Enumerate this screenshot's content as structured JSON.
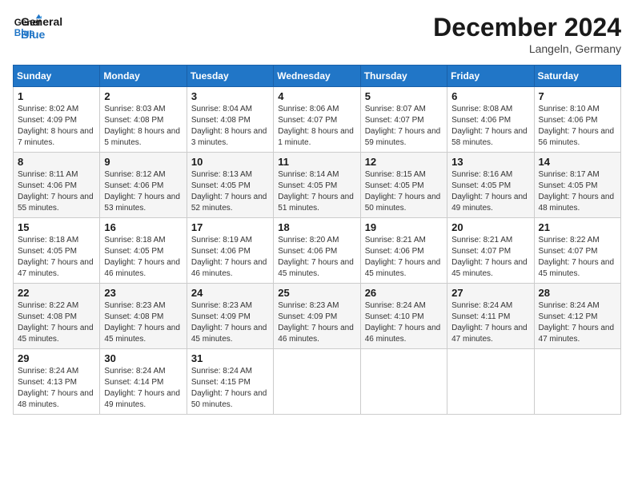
{
  "header": {
    "logo_line1": "General",
    "logo_line2": "Blue",
    "month_title": "December 2024",
    "subtitle": "Langeln, Germany"
  },
  "days_of_week": [
    "Sunday",
    "Monday",
    "Tuesday",
    "Wednesday",
    "Thursday",
    "Friday",
    "Saturday"
  ],
  "weeks": [
    [
      {
        "day": "1",
        "info": "Sunrise: 8:02 AM\nSunset: 4:09 PM\nDaylight: 8 hours and 7 minutes."
      },
      {
        "day": "2",
        "info": "Sunrise: 8:03 AM\nSunset: 4:08 PM\nDaylight: 8 hours and 5 minutes."
      },
      {
        "day": "3",
        "info": "Sunrise: 8:04 AM\nSunset: 4:08 PM\nDaylight: 8 hours and 3 minutes."
      },
      {
        "day": "4",
        "info": "Sunrise: 8:06 AM\nSunset: 4:07 PM\nDaylight: 8 hours and 1 minute."
      },
      {
        "day": "5",
        "info": "Sunrise: 8:07 AM\nSunset: 4:07 PM\nDaylight: 7 hours and 59 minutes."
      },
      {
        "day": "6",
        "info": "Sunrise: 8:08 AM\nSunset: 4:06 PM\nDaylight: 7 hours and 58 minutes."
      },
      {
        "day": "7",
        "info": "Sunrise: 8:10 AM\nSunset: 4:06 PM\nDaylight: 7 hours and 56 minutes."
      }
    ],
    [
      {
        "day": "8",
        "info": "Sunrise: 8:11 AM\nSunset: 4:06 PM\nDaylight: 7 hours and 55 minutes."
      },
      {
        "day": "9",
        "info": "Sunrise: 8:12 AM\nSunset: 4:06 PM\nDaylight: 7 hours and 53 minutes."
      },
      {
        "day": "10",
        "info": "Sunrise: 8:13 AM\nSunset: 4:05 PM\nDaylight: 7 hours and 52 minutes."
      },
      {
        "day": "11",
        "info": "Sunrise: 8:14 AM\nSunset: 4:05 PM\nDaylight: 7 hours and 51 minutes."
      },
      {
        "day": "12",
        "info": "Sunrise: 8:15 AM\nSunset: 4:05 PM\nDaylight: 7 hours and 50 minutes."
      },
      {
        "day": "13",
        "info": "Sunrise: 8:16 AM\nSunset: 4:05 PM\nDaylight: 7 hours and 49 minutes."
      },
      {
        "day": "14",
        "info": "Sunrise: 8:17 AM\nSunset: 4:05 PM\nDaylight: 7 hours and 48 minutes."
      }
    ],
    [
      {
        "day": "15",
        "info": "Sunrise: 8:18 AM\nSunset: 4:05 PM\nDaylight: 7 hours and 47 minutes."
      },
      {
        "day": "16",
        "info": "Sunrise: 8:18 AM\nSunset: 4:05 PM\nDaylight: 7 hours and 46 minutes."
      },
      {
        "day": "17",
        "info": "Sunrise: 8:19 AM\nSunset: 4:06 PM\nDaylight: 7 hours and 46 minutes."
      },
      {
        "day": "18",
        "info": "Sunrise: 8:20 AM\nSunset: 4:06 PM\nDaylight: 7 hours and 45 minutes."
      },
      {
        "day": "19",
        "info": "Sunrise: 8:21 AM\nSunset: 4:06 PM\nDaylight: 7 hours and 45 minutes."
      },
      {
        "day": "20",
        "info": "Sunrise: 8:21 AM\nSunset: 4:07 PM\nDaylight: 7 hours and 45 minutes."
      },
      {
        "day": "21",
        "info": "Sunrise: 8:22 AM\nSunset: 4:07 PM\nDaylight: 7 hours and 45 minutes."
      }
    ],
    [
      {
        "day": "22",
        "info": "Sunrise: 8:22 AM\nSunset: 4:08 PM\nDaylight: 7 hours and 45 minutes."
      },
      {
        "day": "23",
        "info": "Sunrise: 8:23 AM\nSunset: 4:08 PM\nDaylight: 7 hours and 45 minutes."
      },
      {
        "day": "24",
        "info": "Sunrise: 8:23 AM\nSunset: 4:09 PM\nDaylight: 7 hours and 45 minutes."
      },
      {
        "day": "25",
        "info": "Sunrise: 8:23 AM\nSunset: 4:09 PM\nDaylight: 7 hours and 46 minutes."
      },
      {
        "day": "26",
        "info": "Sunrise: 8:24 AM\nSunset: 4:10 PM\nDaylight: 7 hours and 46 minutes."
      },
      {
        "day": "27",
        "info": "Sunrise: 8:24 AM\nSunset: 4:11 PM\nDaylight: 7 hours and 47 minutes."
      },
      {
        "day": "28",
        "info": "Sunrise: 8:24 AM\nSunset: 4:12 PM\nDaylight: 7 hours and 47 minutes."
      }
    ],
    [
      {
        "day": "29",
        "info": "Sunrise: 8:24 AM\nSunset: 4:13 PM\nDaylight: 7 hours and 48 minutes."
      },
      {
        "day": "30",
        "info": "Sunrise: 8:24 AM\nSunset: 4:14 PM\nDaylight: 7 hours and 49 minutes."
      },
      {
        "day": "31",
        "info": "Sunrise: 8:24 AM\nSunset: 4:15 PM\nDaylight: 7 hours and 50 minutes."
      },
      {
        "day": "",
        "info": ""
      },
      {
        "day": "",
        "info": ""
      },
      {
        "day": "",
        "info": ""
      },
      {
        "day": "",
        "info": ""
      }
    ]
  ]
}
